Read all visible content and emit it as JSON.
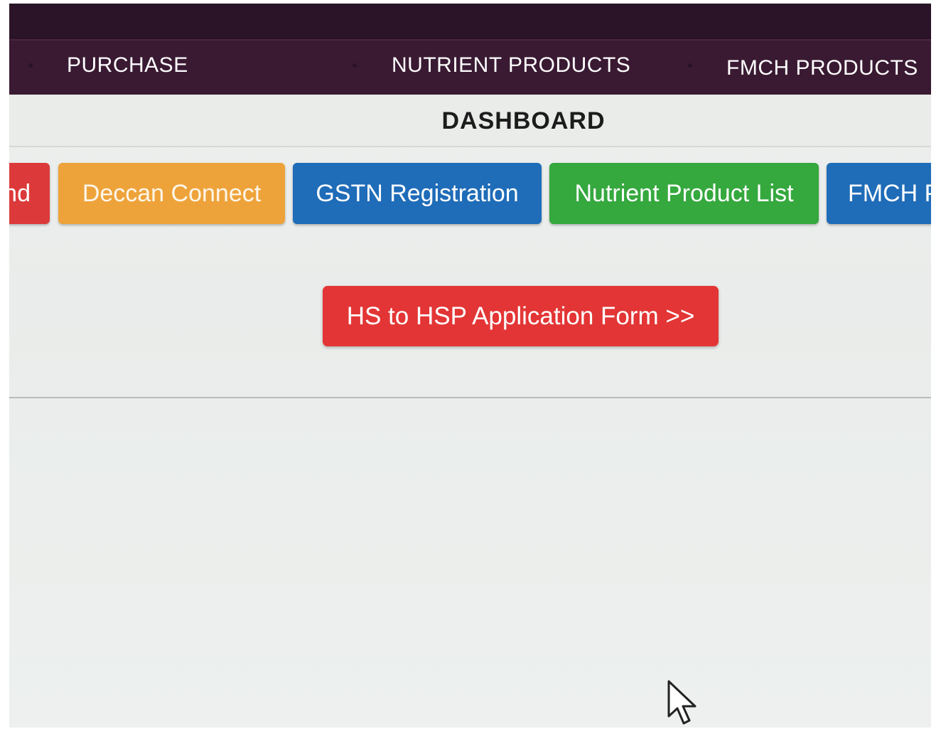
{
  "nav": {
    "items": [
      "PURCHASE",
      "NUTRIENT PRODUCTS",
      "FMCH PRODUCTS"
    ]
  },
  "page_title": "DASHBOARD",
  "tiles": [
    {
      "label": "nd",
      "color": "#dc3a3a"
    },
    {
      "label": "Deccan Connect",
      "color": "#eea33a"
    },
    {
      "label": "GSTN Registration",
      "color": "#1f6cb8"
    },
    {
      "label": "Nutrient Product List",
      "color": "#35a83e"
    },
    {
      "label": "FMCH P",
      "color": "#1f6cb8"
    }
  ],
  "cta": {
    "label": "HS to HSP Application Form >>",
    "color": "#e33535"
  },
  "colors": {
    "navbar": "#3a1a33",
    "topbar": "#2b1427",
    "background": "#eaedea"
  }
}
